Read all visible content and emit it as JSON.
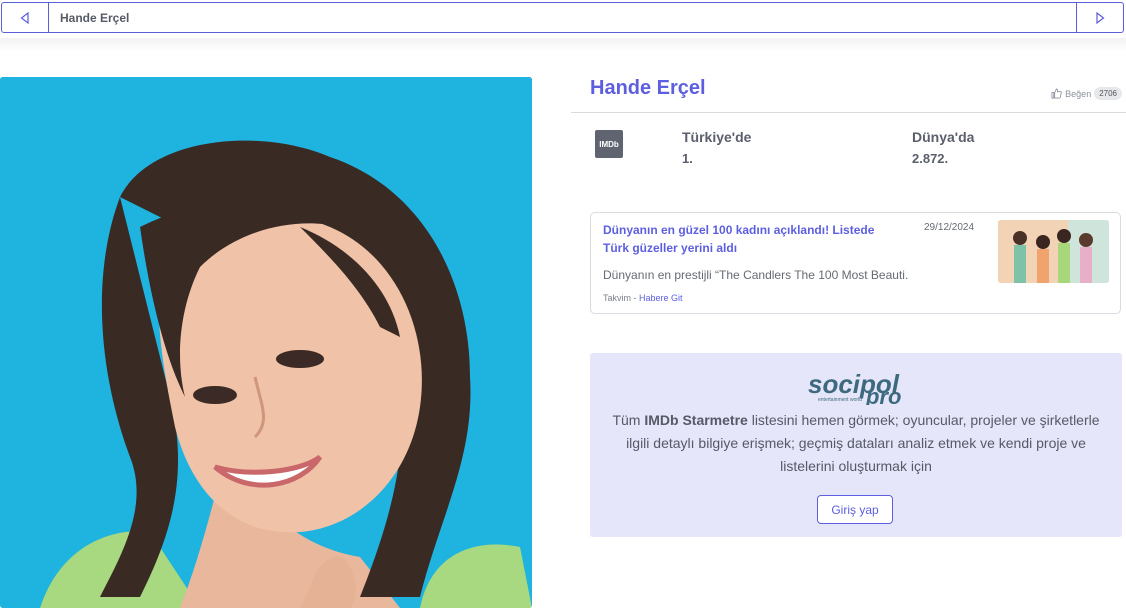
{
  "nav": {
    "title": "Hande Erçel",
    "prev_icon": "caret-left-icon",
    "next_icon": "caret-right-icon"
  },
  "profile": {
    "name": "Hande Erçel",
    "like_label": "Beğen",
    "like_count": "2706"
  },
  "ranking": {
    "source": "IMDb",
    "turkey_label": "Türkiye'de",
    "turkey_value": "1.",
    "world_label": "Dünya'da",
    "world_value": "2.872."
  },
  "news": {
    "title": "Dünyanın en güzel 100 kadını açıklandı! Listede Türk güzeller yerini aldı",
    "date": "29/12/2024",
    "description": "Dünyanın en prestijli “The Candlers The 100 Most Beauti...",
    "source": "Takvim",
    "separator": " - ",
    "link": "Habere Git"
  },
  "promo": {
    "logo_main": "socipol",
    "logo_pro": "pro",
    "logo_tag": "entertainment world",
    "text_pre": "Tüm ",
    "text_bold": "IMDb Starmetre",
    "text_post": " listesini hemen görmek; oyuncular, projeler ve şirketlerle ilgili detaylı bilgiye erişmek; geçmiş dataları analiz etmek ve kendi proje ve listelerini oluşturmak için",
    "button": "Giriş yap"
  },
  "colors": {
    "accent": "#5d5fe0",
    "promo_bg": "#e6e6fa",
    "photo_bg": "#1fb3e0"
  }
}
